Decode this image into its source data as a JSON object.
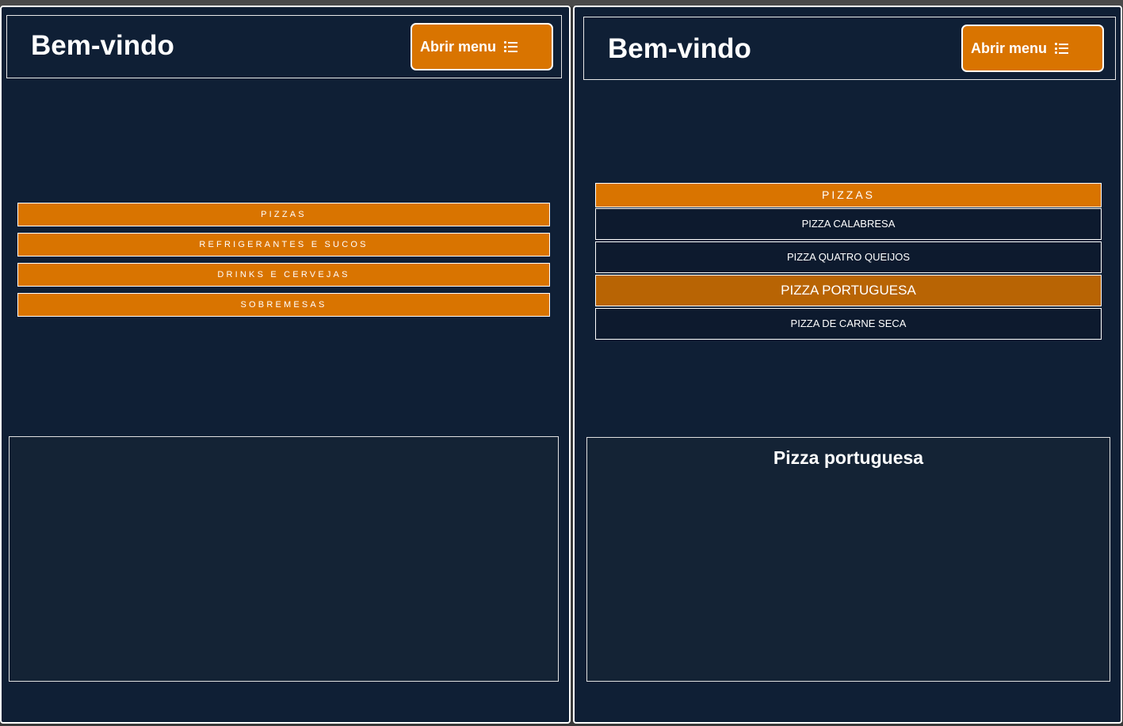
{
  "left_view": {
    "header": {
      "title": "Bem-vindo",
      "menu_button_label": "Abrir menu"
    },
    "categories": [
      "PIZZAS",
      "REFRIGERANTES E SUCOS",
      "DRINKS E CERVEJAS",
      "SOBREMESAS"
    ],
    "detail_title": ""
  },
  "right_view": {
    "header": {
      "title": "Bem-vindo",
      "menu_button_label": "Abrir menu"
    },
    "open_category": "PIZZAS",
    "items": [
      "PIZZA CALABRESA",
      "PIZZA QUATRO QUEIJOS",
      "PIZZA PORTUGUESA",
      "PIZZA DE CARNE SECA"
    ],
    "active_item_index": 2,
    "detail_title": "Pizza portuguesa"
  },
  "icons": {
    "menu_icon": "list-icon"
  },
  "colors": {
    "background": "#0f1f35",
    "accent": "#d97400",
    "active_item": "#b86404",
    "panel": "#142335",
    "item": "#0d1a2e",
    "text": "#ffffff"
  }
}
